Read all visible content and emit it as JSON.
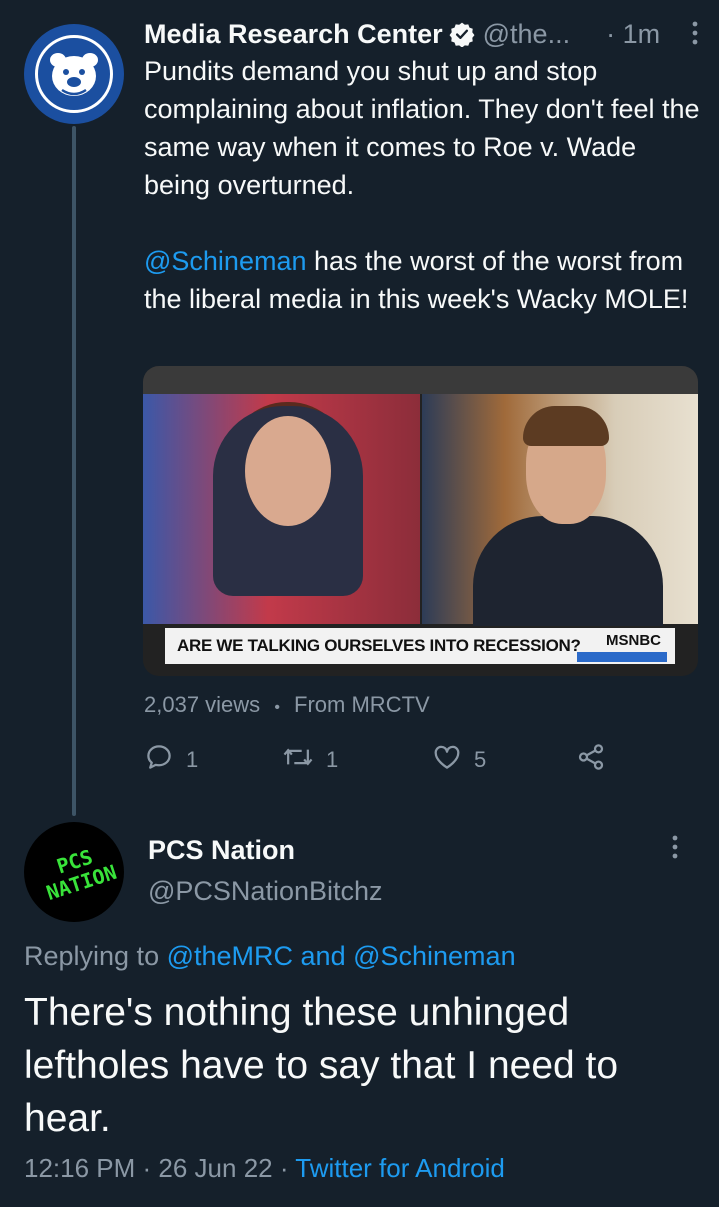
{
  "colors": {
    "background": "#15202b",
    "text_primary": "#f7f9f9",
    "text_secondary": "#8b98a5",
    "link": "#1d9bf0",
    "verified_badge": "#ffffff",
    "pcs_logo_green": "#39e33a",
    "mrc_avatar_blue": "#1b4fa0"
  },
  "parent_tweet": {
    "avatar_icon": "bulldog-logo-icon",
    "display_name": "Media Research Center",
    "verified_icon": "verified-badge-icon",
    "handle": "@the...",
    "time": "1m",
    "more_icon": "more-vertical-icon",
    "text_lines": {
      "line1": "Pundits demand you shut up and stop complaining about inflation. They don't feel the same way when it comes to Roe v. Wade being overturned."
    },
    "mention": "@Schineman",
    "text_after_mention": " has the worst of the worst from the liberal media in this week's Wacky MOLE!",
    "media": {
      "chyron": "ARE WE TALKING OURSELVES INTO RECESSION?",
      "network_logo": "MSNBC"
    },
    "views": "2,037 views",
    "separator": "•",
    "source": "From MRCTV",
    "actions": {
      "reply_count": "1",
      "retweet_count": "1",
      "like_count": "5"
    }
  },
  "reply_tweet": {
    "avatar_text_line1": "PCS",
    "avatar_text_line2": "NATION",
    "display_name": "PCS Nation",
    "handle": "@PCSNationBitchz",
    "replying_prefix": "Replying to ",
    "replying_to_1": "@theMRC",
    "replying_and": " and ",
    "replying_to_2": "@Schineman",
    "text": "There's nothing these unhinged leftholes have to say that I need to hear.",
    "time": "12:16 PM",
    "dot": " · ",
    "date": "26 Jun 22",
    "client": "Twitter for Android"
  }
}
